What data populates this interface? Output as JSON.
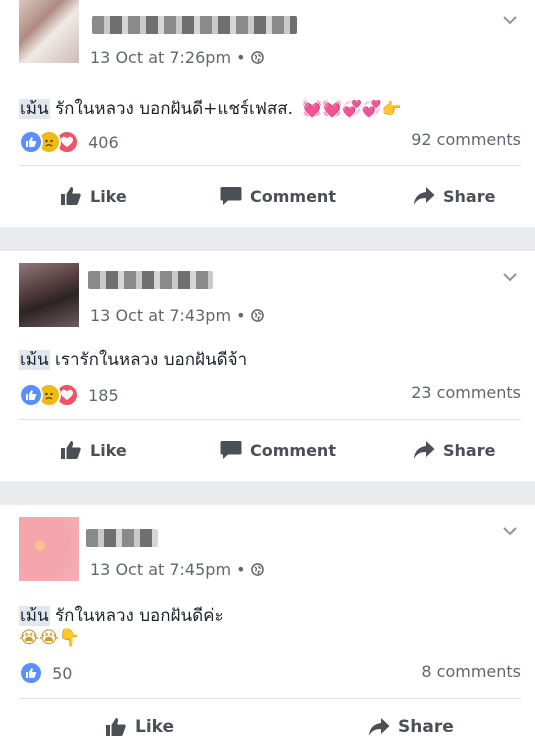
{
  "posts": [
    {
      "timestamp": "13 Oct at 7:26pm",
      "tag": "เม้น",
      "text": " รักในหลวง บอกฝันดี+แชร์เฟสส.",
      "emoji": " 💓💓💞💞👉",
      "reaction_count": "406",
      "comments": "92 comments"
    },
    {
      "timestamp": "13 Oct at 7:43pm",
      "tag": "เม้น",
      "text": " เรารักในหลวง บอกฝันดีจ้า",
      "reaction_count": "185",
      "comments": "23 comments"
    },
    {
      "timestamp": "13 Oct at 7:45pm",
      "tag": "เม้น",
      "text": " รักในหลวง บอกฝันดีค่ะ",
      "line2": "😭😭👇",
      "reaction_count": "50",
      "comments": "8 comments"
    }
  ],
  "actions": {
    "like": "Like",
    "comment": "Comment",
    "share": "Share"
  },
  "separator": " • ",
  "colors": {
    "background": "#e9ebee",
    "like_blue": "#5890ff",
    "love_red": "#f25268",
    "sad_yellow": "#f0ba15"
  }
}
